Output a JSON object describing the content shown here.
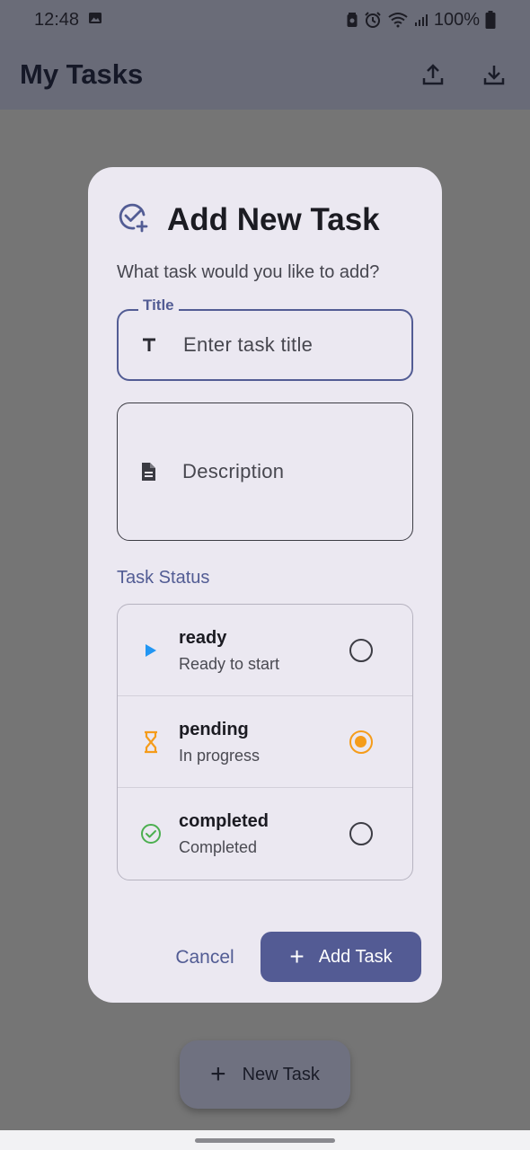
{
  "status_bar": {
    "time": "12:48",
    "battery": "100%",
    "icons": [
      "gallery-icon",
      "battery-saver-icon",
      "alarm-icon",
      "wifi-icon",
      "signal-icon",
      "battery-icon"
    ]
  },
  "app_bar": {
    "title": "My Tasks",
    "actions": [
      "upload-icon",
      "download-icon"
    ]
  },
  "dialog": {
    "title": "Add New Task",
    "subtitle": "What task would you like to add?",
    "title_field": {
      "label": "Title",
      "placeholder": "Enter task title",
      "value": ""
    },
    "description_field": {
      "placeholder": "Description",
      "value": ""
    },
    "status_label": "Task Status",
    "statuses": [
      {
        "name": "ready",
        "description": "Ready to start",
        "icon": "play-icon",
        "selected": false,
        "color": "#2196f3"
      },
      {
        "name": "pending",
        "description": "In progress",
        "icon": "hourglass-icon",
        "selected": true,
        "color": "#f59c1a"
      },
      {
        "name": "completed",
        "description": "Completed",
        "icon": "check-circle-icon",
        "selected": false,
        "color": "#4caf50"
      }
    ],
    "cancel_label": "Cancel",
    "add_label": "Add Task"
  },
  "fab": {
    "label": "New Task"
  },
  "colors": {
    "primary": "#535b94",
    "surface": "#ebe8f1",
    "scrim": "#757575",
    "pending": "#f59c1a"
  }
}
